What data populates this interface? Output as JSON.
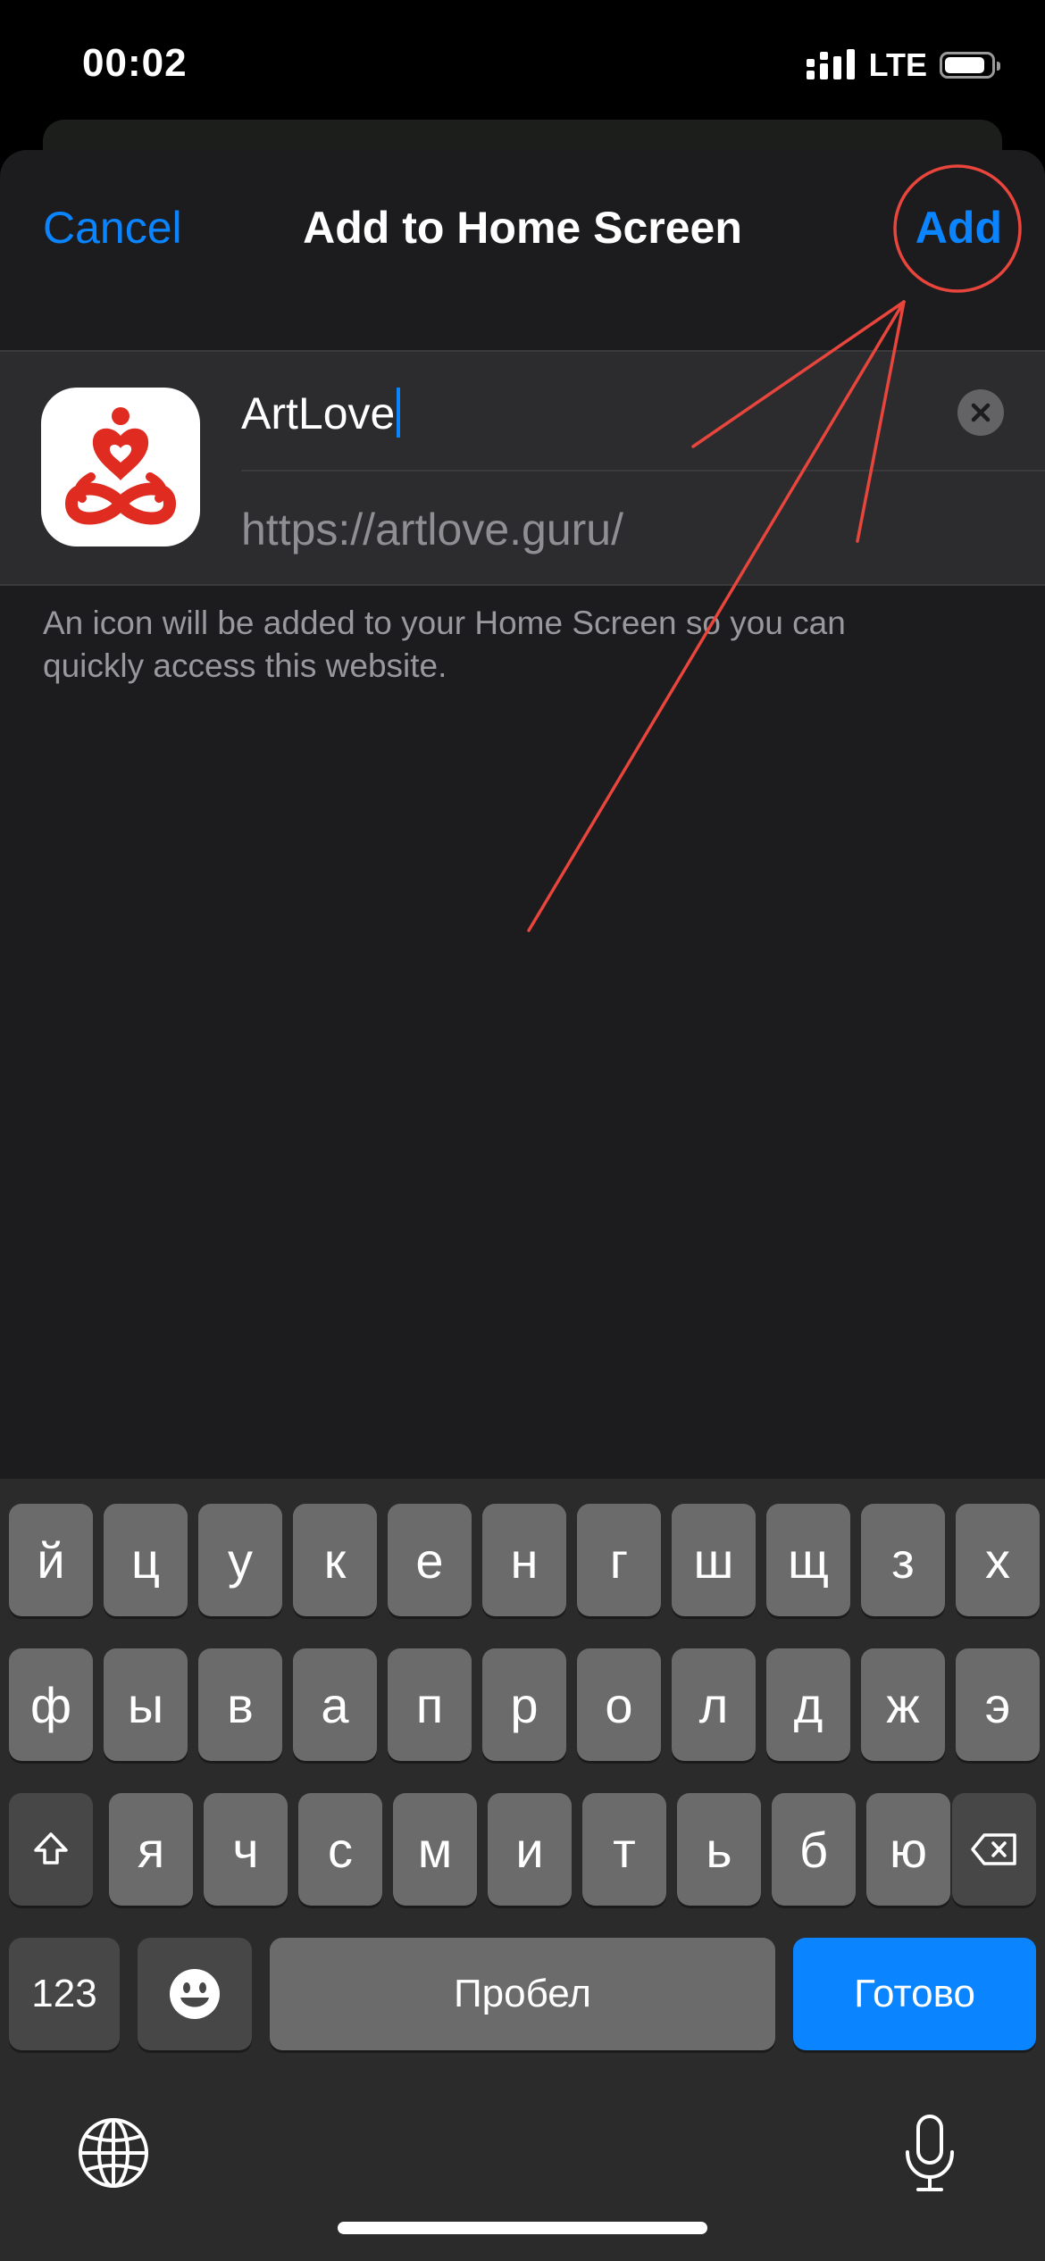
{
  "status": {
    "time": "00:02",
    "network": "LTE"
  },
  "nav": {
    "cancel": "Cancel",
    "title": "Add to Home Screen",
    "add": "Add"
  },
  "form": {
    "name_value": "ArtLove",
    "url": "https://artlove.guru/",
    "app_icon": "meditation-heart-logo-icon"
  },
  "hint": "An icon will be added to your Home Screen so you can quickly access this website.",
  "keyboard": {
    "row1": [
      "й",
      "ц",
      "у",
      "к",
      "е",
      "н",
      "г",
      "ш",
      "щ",
      "з",
      "х"
    ],
    "row2": [
      "ф",
      "ы",
      "в",
      "а",
      "п",
      "р",
      "о",
      "л",
      "д",
      "ж",
      "э"
    ],
    "row3": [
      "я",
      "ч",
      "с",
      "м",
      "и",
      "т",
      "ь",
      "б",
      "ю"
    ],
    "numbers": "123",
    "space": "Пробел",
    "done": "Готово"
  },
  "colors": {
    "accent": "#0a84ff",
    "annotation": "#e8453c",
    "sheet": "#1c1c1e"
  }
}
